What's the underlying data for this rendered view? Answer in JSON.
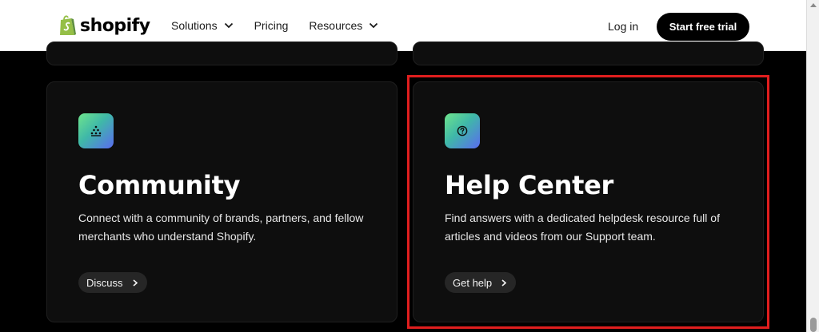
{
  "header": {
    "logo_text": "shopify",
    "nav": [
      {
        "label": "Solutions",
        "has_dropdown": true
      },
      {
        "label": "Pricing",
        "has_dropdown": false
      },
      {
        "label": "Resources",
        "has_dropdown": true
      }
    ],
    "login_label": "Log in",
    "cta_label": "Start free trial"
  },
  "cards": {
    "community": {
      "icon": "community-icon",
      "title": "Community",
      "description": "Connect with a community of brands, partners, and fellow merchants who understand Shopify.",
      "button_label": "Discuss"
    },
    "help": {
      "icon": "help-question-icon",
      "title": "Help Center",
      "description": "Find answers with a dedicated helpdesk resource full of articles and videos from our Support team.",
      "button_label": "Get help"
    }
  },
  "colors": {
    "background": "#000000",
    "card": "#0e0e0e",
    "highlight": "#e01e1e",
    "brand_green": "#95bf47"
  }
}
